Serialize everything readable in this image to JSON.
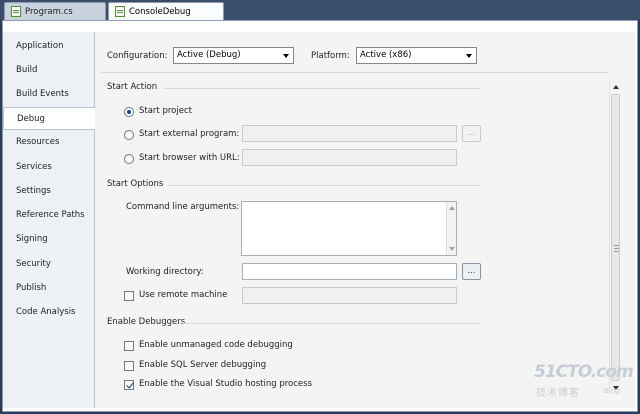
{
  "doc_tabs": [
    {
      "label": "Program.cs",
      "active": false
    },
    {
      "label": "ConsoleDebug",
      "active": true
    }
  ],
  "nav": [
    {
      "label": "Application",
      "selected": false
    },
    {
      "label": "Build",
      "selected": false
    },
    {
      "label": "Build Events",
      "selected": false
    },
    {
      "label": "Debug",
      "selected": true
    },
    {
      "label": "Resources",
      "selected": false
    },
    {
      "label": "Services",
      "selected": false
    },
    {
      "label": "Settings",
      "selected": false
    },
    {
      "label": "Reference Paths",
      "selected": false
    },
    {
      "label": "Signing",
      "selected": false
    },
    {
      "label": "Security",
      "selected": false
    },
    {
      "label": "Publish",
      "selected": false
    },
    {
      "label": "Code Analysis",
      "selected": false
    }
  ],
  "config": {
    "configuration_label": "Configuration:",
    "configuration_value": "Active (Debug)",
    "platform_label": "Platform:",
    "platform_value": "Active (x86)"
  },
  "start_action": {
    "heading": "Start Action",
    "start_project": "Start project",
    "start_external": "Start external program:",
    "start_browser": "Start browser with URL:",
    "browse_label": "...",
    "selected": "start_project"
  },
  "start_options": {
    "heading": "Start Options",
    "cmd_args_label": "Command line arguments:",
    "cmd_args_value": "",
    "working_dir_label": "Working directory:",
    "working_dir_value": "",
    "browse_label": "...",
    "use_remote_label": "Use remote machine",
    "use_remote_checked": false,
    "remote_value": ""
  },
  "debuggers": {
    "heading": "Enable Debuggers",
    "unmanaged": {
      "label": "Enable unmanaged code debugging",
      "checked": false
    },
    "sql": {
      "label": "Enable SQL Server debugging",
      "checked": false
    },
    "hosting": {
      "label": "Enable the Visual Studio hosting process",
      "checked": true
    }
  },
  "watermark": {
    "big": "51CTO.com",
    "small": "技术博客",
    "blog": "Blog"
  }
}
